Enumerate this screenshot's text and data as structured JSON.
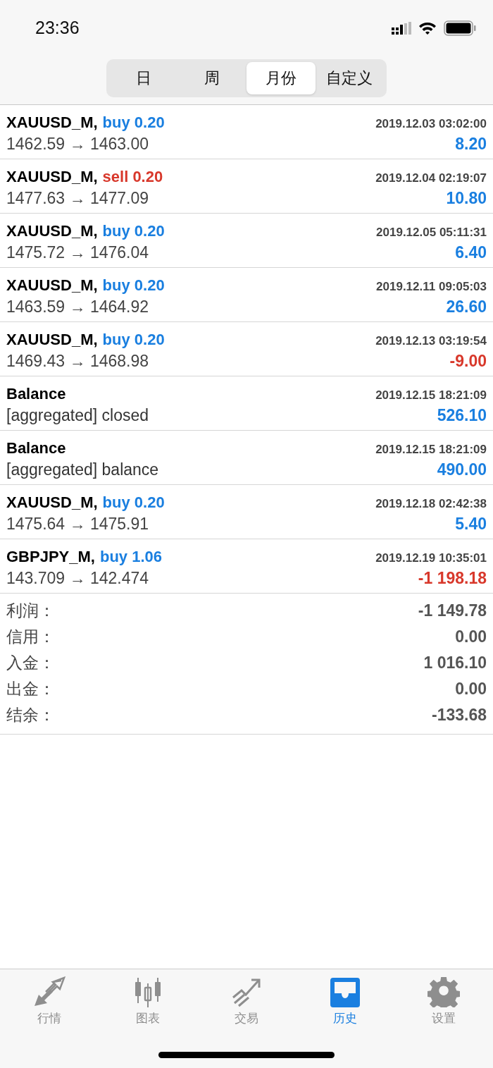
{
  "status_bar": {
    "time": "23:36"
  },
  "period_tabs": [
    {
      "label": "日",
      "selected": false
    },
    {
      "label": "周",
      "selected": false
    },
    {
      "label": "月份",
      "selected": true
    },
    {
      "label": "自定义",
      "selected": false
    }
  ],
  "deals": [
    {
      "kind": "buy",
      "title": "XAUUSD_M,",
      "action": "buy 0.20",
      "time": "2019.12.03 03:02:00",
      "detail": "1462.59 → 1463.00",
      "profit": "8.20",
      "loss": false
    },
    {
      "kind": "sell",
      "title": "XAUUSD_M,",
      "action": "sell 0.20",
      "time": "2019.12.04 02:19:07",
      "detail": "1477.63 → 1477.09",
      "profit": "10.80",
      "loss": false
    },
    {
      "kind": "buy",
      "title": "XAUUSD_M,",
      "action": "buy 0.20",
      "time": "2019.12.05 05:11:31",
      "detail": "1475.72 → 1476.04",
      "profit": "6.40",
      "loss": false
    },
    {
      "kind": "buy",
      "title": "XAUUSD_M,",
      "action": "buy 0.20",
      "time": "2019.12.11 09:05:03",
      "detail": "1463.59 → 1464.92",
      "profit": "26.60",
      "loss": false
    },
    {
      "kind": "buy",
      "title": "XAUUSD_M,",
      "action": "buy 0.20",
      "time": "2019.12.13 03:19:54",
      "detail": "1469.43 → 1468.98",
      "profit": "-9.00",
      "loss": true
    },
    {
      "kind": "balance",
      "title": "Balance",
      "time": "2019.12.15 18:21:09",
      "detail": "[aggregated] closed",
      "profit": "526.10",
      "loss": false
    },
    {
      "kind": "balance",
      "title": "Balance",
      "time": "2019.12.15 18:21:09",
      "detail": "[aggregated] balance",
      "profit": "490.00",
      "loss": false
    },
    {
      "kind": "buy",
      "title": "XAUUSD_M,",
      "action": "buy 0.20",
      "time": "2019.12.18 02:42:38",
      "detail": "1475.64 → 1475.91",
      "profit": "5.40",
      "loss": false
    },
    {
      "kind": "buy",
      "title": "GBPJPY_M,",
      "action": "buy 1.06",
      "time": "2019.12.19 10:35:01",
      "detail": "143.709 → 142.474",
      "profit": "-1 198.18",
      "loss": true
    }
  ],
  "summary": [
    {
      "label": "利润：",
      "value": "-1 149.78"
    },
    {
      "label": "信用：",
      "value": "0.00"
    },
    {
      "label": "入金：",
      "value": "1 016.10"
    },
    {
      "label": "出金：",
      "value": "0.00"
    },
    {
      "label": "结余：",
      "value": "-133.68"
    }
  ],
  "bottom_tabs": [
    {
      "kind": "quotes",
      "label": "行情",
      "selected": false
    },
    {
      "kind": "chart",
      "label": "图表",
      "selected": false
    },
    {
      "kind": "trade",
      "label": "交易",
      "selected": false
    },
    {
      "kind": "history",
      "label": "历史",
      "selected": true
    },
    {
      "kind": "settings",
      "label": "设置",
      "selected": false
    }
  ]
}
